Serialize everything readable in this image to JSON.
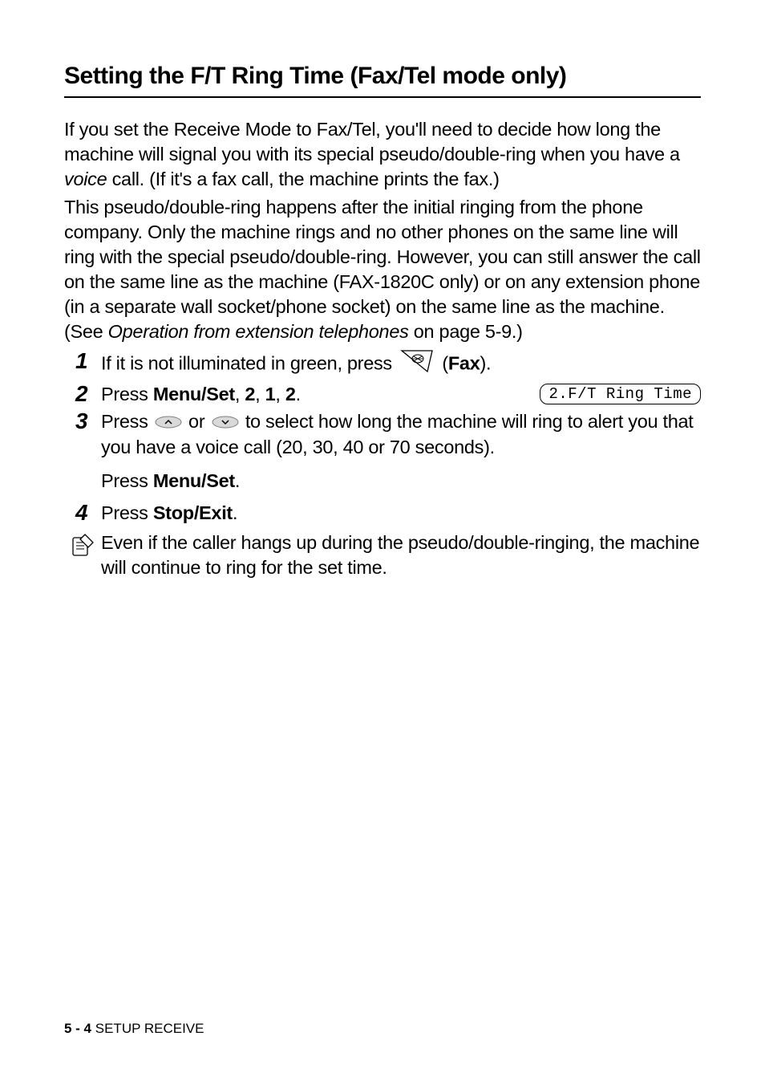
{
  "heading": "Setting the F/T Ring Time (Fax/Tel mode only)",
  "intro1_a": "If you set the Receive Mode to Fax/Tel, you'll need to decide how long the machine will signal you with its special pseudo/double-ring when you have a ",
  "intro1_ital": "voice",
  "intro1_b": " call. (If it's a fax call, the machine prints the fax.)",
  "intro2_a": "This pseudo/double-ring happens after the initial ringing from the phone company. Only the machine rings and no other phones on the same line will ring with the special pseudo/double-ring. However, you can still answer the call on the same line as the machine (FAX-1820C only) or on any extension phone (in a separate wall socket/phone socket) on the same line as the machine. (See ",
  "intro2_ital": "Operation from extension telephones",
  "intro2_b": " on page 5-9.)",
  "step1_a": "If it is not illuminated in green, press ",
  "step1_fax_paren_open": " (",
  "step1_fax": "Fax",
  "step1_fax_paren_close": ").",
  "step2_a": "Press ",
  "step2_menuset": "Menu/Set",
  "step2_sep1": ", ",
  "step2_n1": "2",
  "step2_sep2": ", ",
  "step2_n2": "1",
  "step2_sep3": ", ",
  "step2_n3": "2",
  "step2_end": ".",
  "step3_a": "Press ",
  "step3_or": " or ",
  "step3_b": " to select how long the machine will ring to alert you that you have a voice call (20, 30, 40 or 70 seconds).",
  "step3_press": "Press ",
  "step3_menuset": "Menu/Set",
  "step3_end": ".",
  "step4_a": "Press ",
  "step4_stop": "Stop/Exit",
  "step4_end": ".",
  "lcd": "2.F/T Ring Time",
  "note": "Even if the caller hangs up during the pseudo/double-ringing, the machine will continue to ring for the set time.",
  "footer_page": "5 - 4",
  "footer_section": "   SETUP RECEIVE",
  "nums": {
    "n1": "1",
    "n2": "2",
    "n3": "3",
    "n4": "4"
  }
}
